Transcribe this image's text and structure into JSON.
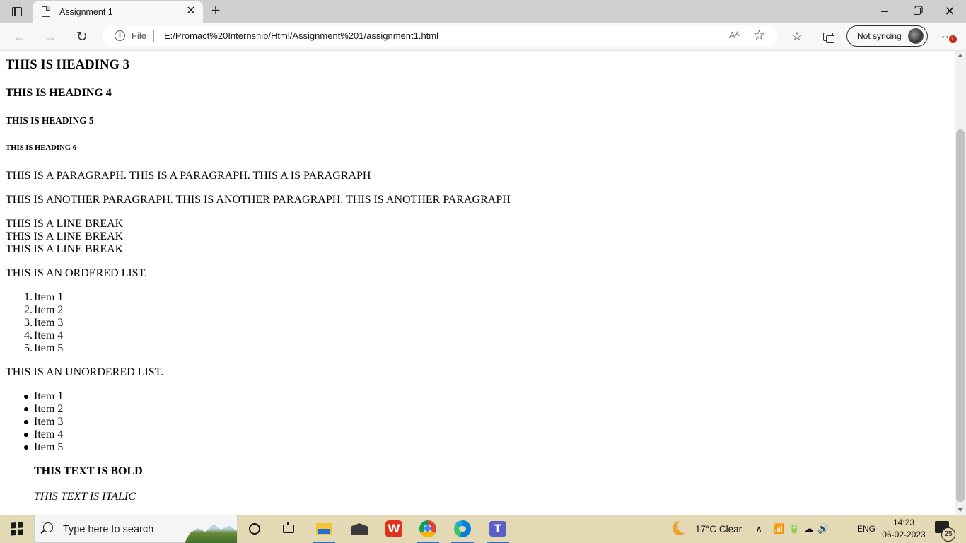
{
  "browser": {
    "tab_title": "Assignment 1",
    "address_scheme_label": "File",
    "url": "E:/Promact%20Internship/Html/Assignment%201/assignment1.html",
    "read_aloud_label": "Aᴬ",
    "profile_label": "Not syncing",
    "more_badge": "1"
  },
  "page": {
    "h3": "THIS IS HEADING 3",
    "h4": "THIS IS HEADING 4",
    "h5": "THIS IS HEADING 5",
    "h6": "THIS IS HEADING 6",
    "paragraph1": "THIS IS A PARAGRAPH. THIS IS A PARAGRAPH. THIS A IS PARAGRAPH",
    "paragraph2": "THIS IS ANOTHER PARAGRAPH. THIS IS ANOTHER PARAGRAPH. THIS IS ANOTHER PARAGRAPH",
    "line_breaks": [
      "THIS IS A LINE BREAK",
      "THIS IS A LINE BREAK",
      "THIS IS A LINE BREAK"
    ],
    "ordered_intro": "THIS IS AN ORDERED LIST.",
    "ordered_numbers": [
      "1.",
      "2.",
      "3.",
      "4.",
      "5."
    ],
    "ordered_items": [
      "Item 1",
      "Item 2",
      "Item 3",
      "Item 4",
      "Item 5"
    ],
    "unordered_intro": "THIS IS AN UNORDERED LIST.",
    "unordered_items": [
      "Item 1",
      "Item 2",
      "Item 3",
      "Item 4",
      "Item 5"
    ],
    "bold_text": "THIS TEXT IS BOLD",
    "italic_text": "THIS TEXT IS ITALIC"
  },
  "taskbar": {
    "search_placeholder": "Type here to search",
    "weather": "17°C  Clear",
    "language": "ENG",
    "time": "14:23",
    "date": "06-02-2023",
    "notification_count": "25",
    "wps_letter": "W",
    "teams_letter": "T"
  },
  "colors": {
    "tabstrip": "#cfcfcf",
    "toolbar": "#f7f7f7",
    "taskbar": "#e3d9b5",
    "accent": "#1f6fd6"
  }
}
